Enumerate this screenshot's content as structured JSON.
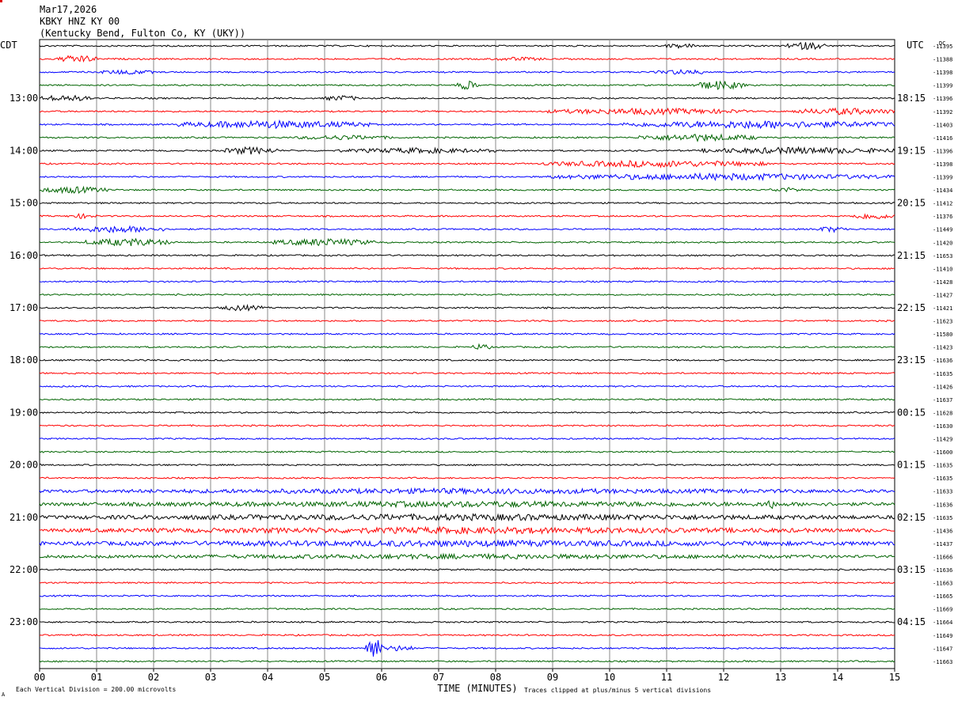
{
  "header": {
    "date": "Mar17,2026",
    "station": "KBKY HNZ KY 00",
    "location": "(Kentucky Bend, Fulton Co, KY (UKY))"
  },
  "chart_data": {
    "type": "helicorder",
    "left_timezone": "CDT",
    "right_timezone": "UTC",
    "dc_label": "DC",
    "x_axis_title": "TIME (MINUTES)",
    "x_ticks": [
      "00",
      "01",
      "02",
      "03",
      "04",
      "05",
      "06",
      "07",
      "08",
      "09",
      "10",
      "11",
      "12",
      "13",
      "14",
      "15"
    ],
    "xlim": [
      0,
      15
    ],
    "trace_colors": [
      "#000000",
      "#ff0000",
      "#0000ff",
      "#006400"
    ],
    "left_hour_labels": [
      {
        "trace": 4,
        "label": "13:00"
      },
      {
        "trace": 8,
        "label": "14:00"
      },
      {
        "trace": 12,
        "label": "15:00"
      },
      {
        "trace": 16,
        "label": "16:00"
      },
      {
        "trace": 20,
        "label": "17:00"
      },
      {
        "trace": 24,
        "label": "18:00"
      },
      {
        "trace": 28,
        "label": "19:00"
      },
      {
        "trace": 32,
        "label": "20:00"
      },
      {
        "trace": 36,
        "label": "21:00"
      },
      {
        "trace": 40,
        "label": "22:00"
      },
      {
        "trace": 44,
        "label": "23:00"
      }
    ],
    "right_hour_labels": [
      {
        "trace": 4,
        "label": "18:15"
      },
      {
        "trace": 8,
        "label": "19:15"
      },
      {
        "trace": 12,
        "label": "20:15"
      },
      {
        "trace": 16,
        "label": "21:15"
      },
      {
        "trace": 20,
        "label": "22:15"
      },
      {
        "trace": 24,
        "label": "23:15"
      },
      {
        "trace": 28,
        "label": "00:15"
      },
      {
        "trace": 32,
        "label": "01:15"
      },
      {
        "trace": 36,
        "label": "02:15"
      },
      {
        "trace": 40,
        "label": "03:15"
      },
      {
        "trace": 44,
        "label": "04:15"
      }
    ],
    "dc_offsets": [
      "-11395",
      "-11388",
      "-11398",
      "-11399",
      "-11396",
      "-11392",
      "-11403",
      "-11416",
      "-11396",
      "-11398",
      "-11399",
      "-11434",
      "-11412",
      "-11376",
      "-11449",
      "-11420",
      "-11653",
      "-11410",
      "-11428",
      "-11427",
      "-11421",
      "-11623",
      "-11580",
      "-11423",
      "-11636",
      "-11635",
      "-11426",
      "-11637",
      "-11628",
      "-11630",
      "-11429",
      "-11600",
      "-11635",
      "-11635",
      "-11633",
      "-11636",
      "-11635",
      "-11436",
      "-11437",
      "-11666",
      "-11636",
      "-11663",
      "-11665",
      "-11669",
      "-11664",
      "-11649",
      "-11647",
      "-11663"
    ],
    "num_traces": 48,
    "minutes_per_trace": 15,
    "activity": [
      {
        "trace": 0,
        "from_min": 13.1,
        "to_min": 13.8,
        "level": 1.6
      },
      {
        "trace": 0,
        "from_min": 10.9,
        "to_min": 11.6,
        "level": 1.0
      },
      {
        "trace": 1,
        "from_min": 0.3,
        "to_min": 1.0,
        "level": 1.6
      },
      {
        "trace": 1,
        "from_min": 7.9,
        "to_min": 8.9,
        "level": 0.8
      },
      {
        "trace": 2,
        "from_min": 1.0,
        "to_min": 2.0,
        "level": 1.0
      },
      {
        "trace": 2,
        "from_min": 10.8,
        "to_min": 11.8,
        "level": 1.1
      },
      {
        "trace": 3,
        "from_min": 7.3,
        "to_min": 7.7,
        "level": 1.8
      },
      {
        "trace": 3,
        "from_min": 11.4,
        "to_min": 12.4,
        "level": 1.8
      },
      {
        "trace": 4,
        "from_min": 0.0,
        "to_min": 0.9,
        "level": 1.4
      },
      {
        "trace": 4,
        "from_min": 5.0,
        "to_min": 5.6,
        "level": 1.2
      },
      {
        "trace": 5,
        "from_min": 8.9,
        "to_min": 12.4,
        "level": 1.3
      },
      {
        "trace": 5,
        "from_min": 13.2,
        "to_min": 15.0,
        "level": 1.4
      },
      {
        "trace": 6,
        "from_min": 2.4,
        "to_min": 5.8,
        "level": 1.6
      },
      {
        "trace": 6,
        "from_min": 10.2,
        "to_min": 15.0,
        "level": 1.6
      },
      {
        "trace": 7,
        "from_min": 4.5,
        "to_min": 6.2,
        "level": 1.0
      },
      {
        "trace": 7,
        "from_min": 10.5,
        "to_min": 12.6,
        "level": 1.5
      },
      {
        "trace": 8,
        "from_min": 3.2,
        "to_min": 4.2,
        "level": 1.5
      },
      {
        "trace": 8,
        "from_min": 5.2,
        "to_min": 8.0,
        "level": 1.1
      },
      {
        "trace": 8,
        "from_min": 11.6,
        "to_min": 15.0,
        "level": 1.4
      },
      {
        "trace": 9,
        "from_min": 8.8,
        "to_min": 12.8,
        "level": 1.4
      },
      {
        "trace": 10,
        "from_min": 8.9,
        "to_min": 15.0,
        "level": 1.4
      },
      {
        "trace": 11,
        "from_min": 0.0,
        "to_min": 1.2,
        "level": 1.4
      },
      {
        "trace": 11,
        "from_min": 12.8,
        "to_min": 13.4,
        "level": 1.0
      },
      {
        "trace": 13,
        "from_min": 0.5,
        "to_min": 1.0,
        "level": 1.0
      },
      {
        "trace": 13,
        "from_min": 14.2,
        "to_min": 15.0,
        "level": 1.4
      },
      {
        "trace": 14,
        "from_min": 0.5,
        "to_min": 2.2,
        "level": 1.4
      },
      {
        "trace": 14,
        "from_min": 13.6,
        "to_min": 14.2,
        "level": 1.2
      },
      {
        "trace": 15,
        "from_min": 0.8,
        "to_min": 2.3,
        "level": 1.6
      },
      {
        "trace": 15,
        "from_min": 4.1,
        "to_min": 5.9,
        "level": 1.5
      },
      {
        "trace": 20,
        "from_min": 3.2,
        "to_min": 3.9,
        "level": 1.3
      },
      {
        "trace": 23,
        "from_min": 7.6,
        "to_min": 7.9,
        "level": 1.4
      },
      {
        "trace": 34,
        "from_min": 0.0,
        "to_min": 15.0,
        "level": 1.1
      },
      {
        "trace": 35,
        "from_min": 0.0,
        "to_min": 15.0,
        "level": 1.2
      },
      {
        "trace": 35,
        "from_min": 12.7,
        "to_min": 12.9,
        "level": 2.5
      },
      {
        "trace": 36,
        "from_min": 0.0,
        "to_min": 15.0,
        "level": 1.3
      },
      {
        "trace": 37,
        "from_min": 0.0,
        "to_min": 15.0,
        "level": 1.3
      },
      {
        "trace": 38,
        "from_min": 0.0,
        "to_min": 15.0,
        "level": 1.3
      },
      {
        "trace": 39,
        "from_min": 0.0,
        "to_min": 15.0,
        "level": 1.0
      },
      {
        "trace": 46,
        "from_min": 5.7,
        "to_min": 6.0,
        "level": 5.0
      },
      {
        "trace": 46,
        "from_min": 6.0,
        "to_min": 6.6,
        "level": 1.2
      }
    ]
  },
  "footer": {
    "scale_note": "Each Vertical Division = 200.00 microvolts",
    "clip_note": "Traces clipped at plus/minus 5 vertical divisions"
  }
}
